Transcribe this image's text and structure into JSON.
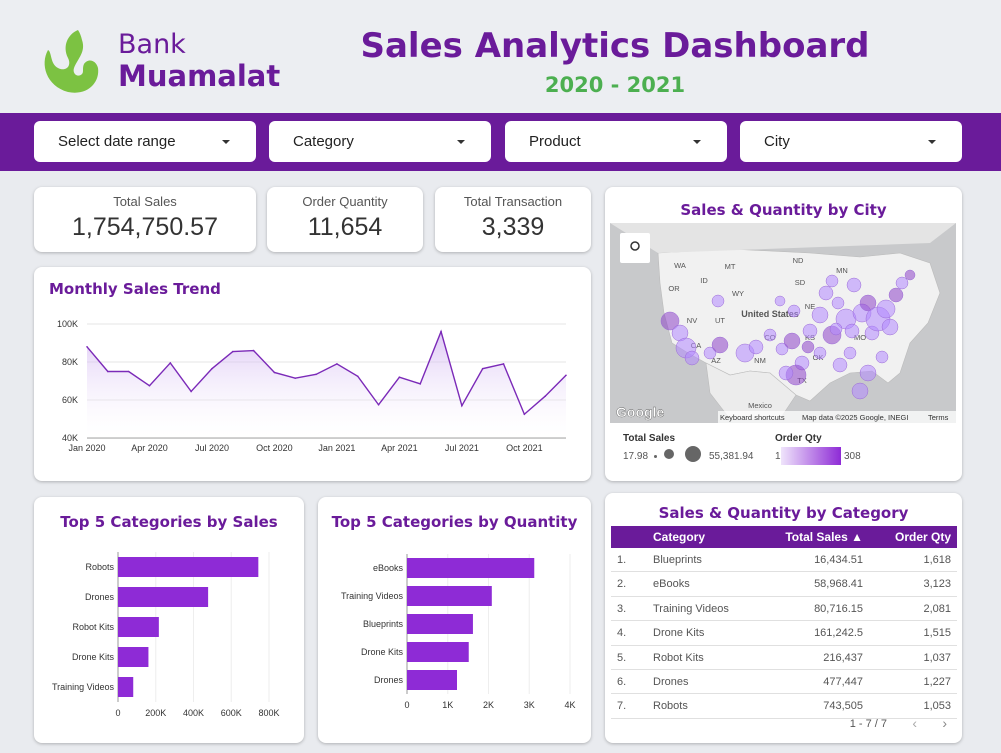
{
  "brand": {
    "line1": "Bank",
    "line2": "Muamalat"
  },
  "header": {
    "title": "Sales Analytics Dashboard",
    "subtitle": "2020 - 2021"
  },
  "filters": [
    {
      "label": "Select date range"
    },
    {
      "label": "Category"
    },
    {
      "label": "Product"
    },
    {
      "label": "City"
    }
  ],
  "kpis": [
    {
      "label": "Total Sales",
      "value": "1,754,750.57"
    },
    {
      "label": "Order Quantity",
      "value": "11,654"
    },
    {
      "label": "Total Transaction",
      "value": "3,339"
    }
  ],
  "trend": {
    "title": "Monthly Sales Trend",
    "y_ticks": [
      "100K",
      "80K",
      "60K",
      "40K"
    ],
    "x_ticks": [
      "Jan 2020",
      "Apr 2020",
      "Jul 2020",
      "Oct 2020",
      "Jan 2021",
      "Apr 2021",
      "Jul 2021",
      "Oct 2021"
    ]
  },
  "map": {
    "title": "Sales & Quantity by City",
    "labels": [
      "WA",
      "MT",
      "ND",
      "MN",
      "OR",
      "ID",
      "WY",
      "SD",
      "NE",
      "United States",
      "NV",
      "UT",
      "CO",
      "KS",
      "MO",
      "CA",
      "AZ",
      "NM",
      "OK",
      "TX",
      "Mexico"
    ],
    "attribution": [
      "Google",
      "Keyboard shortcuts",
      "Map data ©2025 Google, INEGI",
      "Terms"
    ],
    "legend": {
      "sales_label": "Total Sales",
      "sales_min": "17.98",
      "sales_max": "55,381.94",
      "qty_label": "Order Qty",
      "qty_min": "1",
      "qty_max": "308"
    },
    "colors": {
      "bubble": "#b388ff",
      "bubble_dark": "#8e44c9"
    }
  },
  "cat_sales": {
    "title": "Top 5 Categories by Sales",
    "x_ticks": [
      "0",
      "200K",
      "400K",
      "600K",
      "800K"
    ]
  },
  "cat_qty": {
    "title": "Top 5 Categories by Quantity",
    "x_ticks": [
      "0",
      "1K",
      "2K",
      "3K",
      "4K"
    ]
  },
  "table": {
    "title": "Sales & Quantity by Category",
    "headers": [
      "Category",
      "Total Sales ▲",
      "Order Qty"
    ],
    "rows": [
      {
        "n": "1.",
        "category": "Blueprints",
        "sales": "16,434.51",
        "qty": "1,618"
      },
      {
        "n": "2.",
        "category": "eBooks",
        "sales": "58,968.41",
        "qty": "3,123"
      },
      {
        "n": "3.",
        "category": "Training Videos",
        "sales": "80,716.15",
        "qty": "2,081"
      },
      {
        "n": "4.",
        "category": "Drone Kits",
        "sales": "161,242.5",
        "qty": "1,515"
      },
      {
        "n": "5.",
        "category": "Robot Kits",
        "sales": "216,437",
        "qty": "1,037"
      },
      {
        "n": "6.",
        "category": "Drones",
        "sales": "477,447",
        "qty": "1,227"
      },
      {
        "n": "7.",
        "category": "Robots",
        "sales": "743,505",
        "qty": "1,053"
      }
    ],
    "pagination": "1 - 7 / 7"
  },
  "colors": {
    "accent": "#6a1b9a",
    "bar": "#8e2bd6",
    "green": "#4caf50",
    "line": "#7b2ab8"
  },
  "chart_data": [
    {
      "type": "line",
      "title": "Monthly Sales Trend",
      "x": [
        "Jan 2020",
        "Feb 2020",
        "Mar 2020",
        "Apr 2020",
        "May 2020",
        "Jun 2020",
        "Jul 2020",
        "Aug 2020",
        "Sep 2020",
        "Oct 2020",
        "Nov 2020",
        "Dec 2020",
        "Jan 2021",
        "Feb 2021",
        "Mar 2021",
        "Apr 2021",
        "May 2021",
        "Jun 2021",
        "Jul 2021",
        "Aug 2021",
        "Sep 2021",
        "Oct 2021",
        "Nov 2021",
        "Dec 2021"
      ],
      "series": [
        {
          "values": [
            88000,
            75000,
            75000,
            67500,
            79500,
            64500,
            76500,
            85500,
            86000,
            74500,
            71500,
            73500,
            79000,
            72500,
            57500,
            72000,
            68500,
            96000,
            57000,
            76500,
            79000,
            52500,
            62000,
            73000
          ]
        }
      ],
      "ylim": [
        40000,
        100000
      ]
    },
    {
      "type": "bar",
      "title": "Top 5 Categories by Sales",
      "categories": [
        "Robots",
        "Drones",
        "Robot Kits",
        "Drone Kits",
        "Training Videos"
      ],
      "values": [
        743505,
        477447,
        216437,
        161242.5,
        80716.15
      ],
      "xlim": [
        0,
        800000
      ]
    },
    {
      "type": "bar",
      "title": "Top 5 Categories by Quantity",
      "categories": [
        "eBooks",
        "Training Videos",
        "Blueprints",
        "Drone Kits",
        "Drones"
      ],
      "values": [
        3123,
        2081,
        1618,
        1515,
        1227
      ],
      "xlim": [
        0,
        4000
      ]
    }
  ]
}
